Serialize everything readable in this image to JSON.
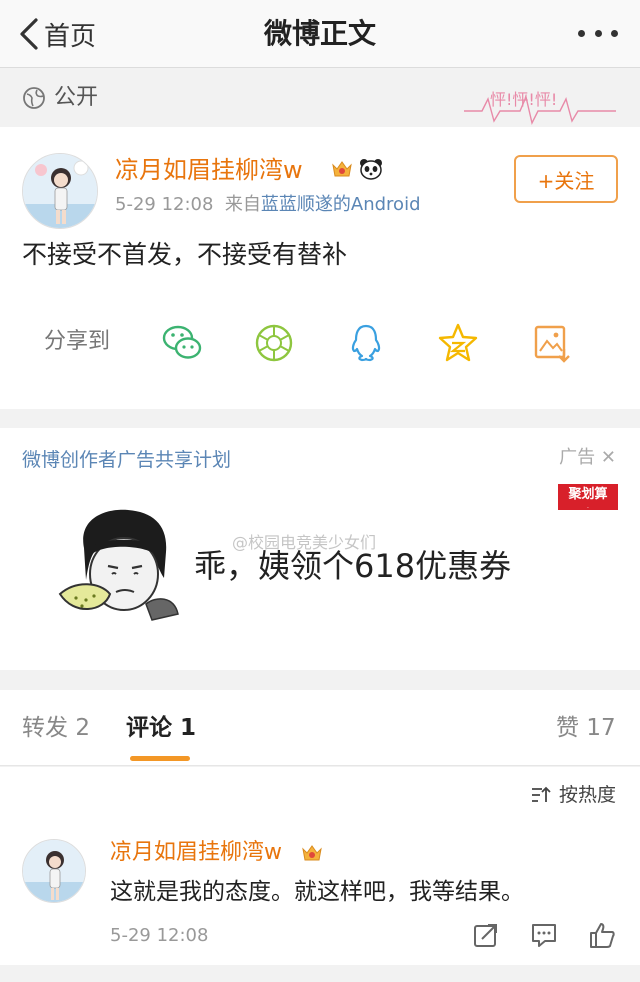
{
  "nav": {
    "back_label": "首页",
    "title": "微博正文"
  },
  "visibility": {
    "label": "公开",
    "decoration": "怦!怦!怦!"
  },
  "post": {
    "author": "凉月如眉挂柳湾w",
    "time": "5-29 12:08",
    "source_prefix": "来自",
    "source": "蓝蓝顺遂的Android",
    "follow_label": "+关注",
    "content": "不接受不首发，不接受有替补",
    "share_label": "分享到",
    "share_icons": [
      "wechat-icon",
      "moments-icon",
      "qq-icon",
      "qzone-icon",
      "save-image-icon"
    ]
  },
  "ad": {
    "title": "微博创作者广告共享计划",
    "tag": "广告",
    "brand_badge": "聚划算",
    "watermark": "@校园电竞美少女们",
    "slogan": "乖，姨领个618优惠券"
  },
  "tabs": {
    "repost": "转发",
    "repost_count": "2",
    "comment": "评论",
    "comment_count": "1",
    "like": "赞",
    "like_count": "17"
  },
  "comments": {
    "sort_label": "按热度",
    "items": [
      {
        "author": "凉月如眉挂柳湾w",
        "text": "这就是我的态度。就这样吧，我等结果。",
        "time": "5-29 12:08"
      }
    ]
  },
  "colors": {
    "accent": "#e8750d",
    "link": "#5b86b5",
    "tab_underline": "#f39726"
  }
}
